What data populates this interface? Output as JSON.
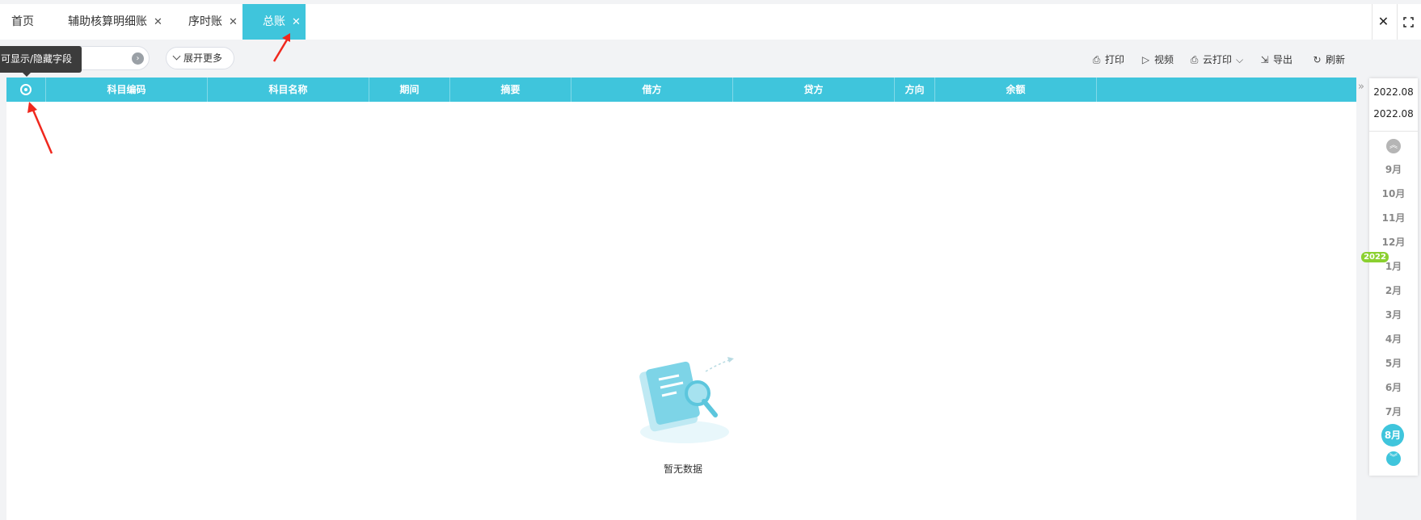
{
  "tabs": [
    {
      "label": "首页",
      "closable": false
    },
    {
      "label": "辅助核算明细账",
      "closable": true
    },
    {
      "label": "序时账",
      "closable": true
    },
    {
      "label": "总账",
      "closable": true,
      "active": true
    }
  ],
  "window": {
    "close_icon": "close-icon",
    "fullscreen_icon": "fullscreen-icon"
  },
  "toolbar": {
    "tooltip": "可显示/隐藏字段",
    "expand_label": "展开更多",
    "print": "打印",
    "video": "视频",
    "cloud_print": "云打印",
    "export": "导出",
    "refresh": "刷新"
  },
  "table": {
    "columns": [
      "科目编码",
      "科目名称",
      "期间",
      "摘要",
      "借方",
      "贷方",
      "方向",
      "余额"
    ]
  },
  "empty": {
    "text": "暂无数据"
  },
  "period": {
    "start": "2022.08",
    "end": "2022.08",
    "months": [
      "9月",
      "10月",
      "11月",
      "12月",
      "1月",
      "2月",
      "3月",
      "4月",
      "5月",
      "6月",
      "7月",
      "8月"
    ],
    "selected": "8月",
    "year_badge": "2022"
  },
  "colors": {
    "accent": "#3fc5dc",
    "badge": "#8bd030",
    "annotation": "#f0281e"
  }
}
